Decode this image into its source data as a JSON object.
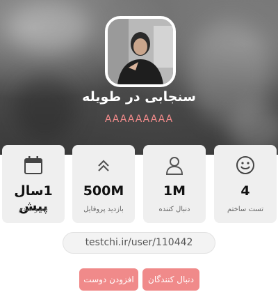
{
  "profile": {
    "name": "سنجابی در طویله",
    "handle": "AAAAAAAAA",
    "avatar_alt": "avatar"
  },
  "stats": [
    {
      "icon": "calendar-icon",
      "value": "1سال پیش",
      "label": "عضو شدم"
    },
    {
      "icon": "chevrons-up-icon",
      "value": "500M",
      "label": "بازدید پروفایل"
    },
    {
      "icon": "user-icon",
      "value": "1M",
      "label": "دنبال کننده"
    },
    {
      "icon": "smiley-icon",
      "value": "4",
      "label": "تست ساختم"
    }
  ],
  "profile_url": "testchi.ir/user/110442",
  "actions": {
    "add_friend": "افزودن دوست",
    "followers": "دنبال کنندگان"
  },
  "colors": {
    "accent": "#f08a8a",
    "handle": "#f28b8b",
    "card_bg": "#efefef",
    "icon": "#444444"
  }
}
